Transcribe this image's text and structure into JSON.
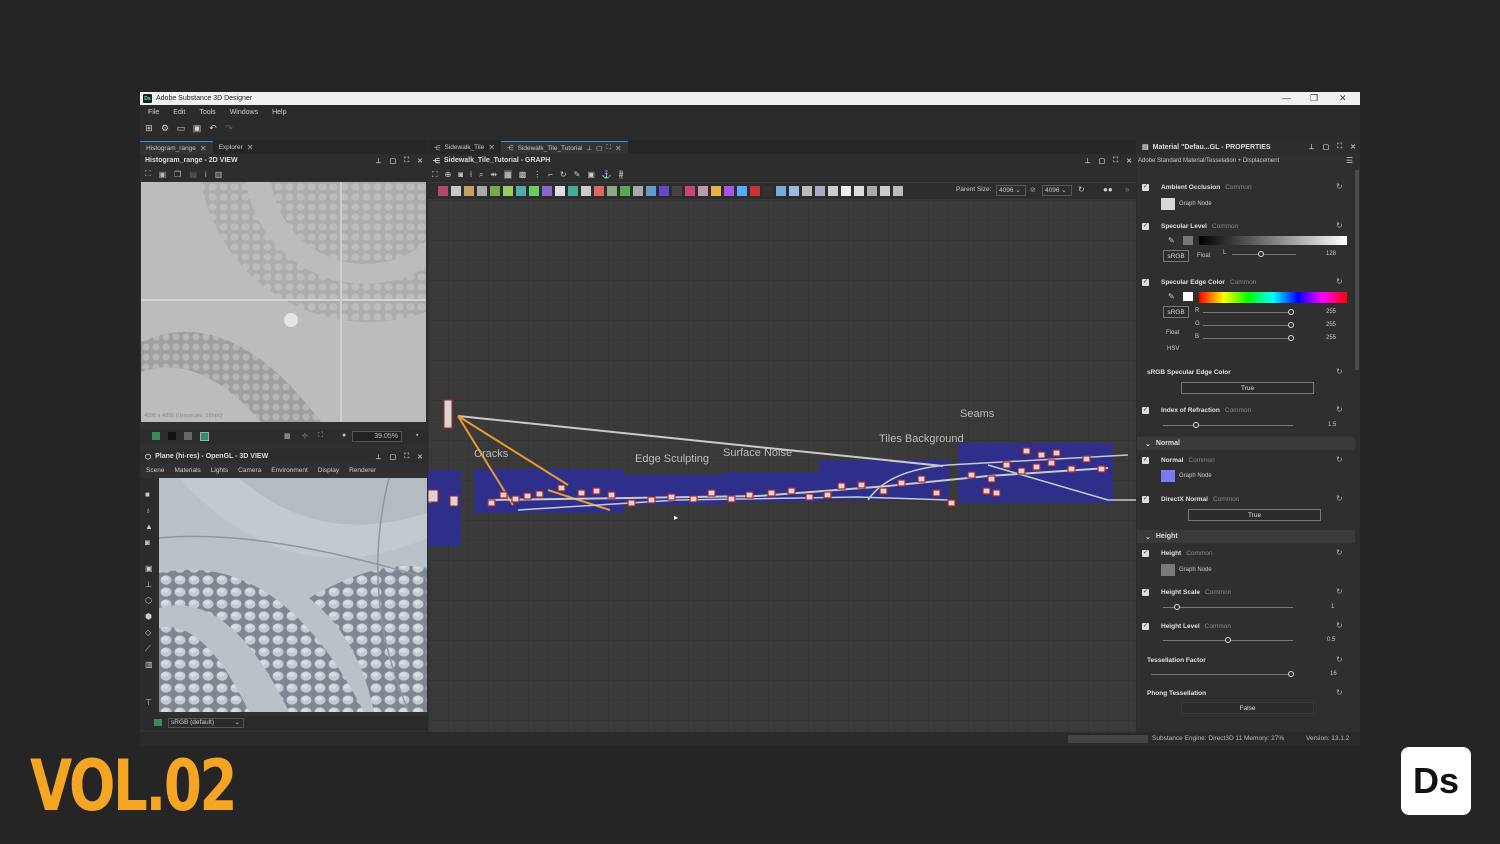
{
  "overlay": {
    "volume": "VOL.02",
    "badge": "Ds"
  },
  "app": {
    "title": "Adobe Substance 3D Designer",
    "logo": "Ds",
    "menu": [
      "File",
      "Edit",
      "Tools",
      "Windows",
      "Help"
    ]
  },
  "left_top": {
    "tabs": [
      "Histogram_range",
      "Explorer"
    ],
    "title": "Histogram_range - 2D VIEW",
    "zoom": "39.05%",
    "caption": "4096 x 4096 (Grayscale, 16bpc)"
  },
  "left_bottom": {
    "title": "Plane (hi-res) - OpenGL - 3D VIEW",
    "menu": [
      "Scene",
      "Materials",
      "Lights",
      "Camera",
      "Environment",
      "Display",
      "Renderer"
    ],
    "colorspace": "sRGB (default)"
  },
  "graph": {
    "tabs": [
      "Sidewalk_Tile",
      "Sidewalk_Tile_Tutorial"
    ],
    "title": "Sidewalk_Tile_Tutorial - GRAPH",
    "parent_size_label": "Parent Size:",
    "parent_size": "4096",
    "size2": "4096",
    "frames": [
      "Cracks",
      "Edge Sculpting",
      "Surface Noise",
      "Tiles Background",
      "Seams"
    ]
  },
  "properties": {
    "title": "Material \"Defau...GL - PROPERTIES",
    "subtitle": "Adobe Standard Material/Tesselation + Displacement",
    "common": "Common",
    "graph_node": "Graph Node",
    "ambient_occlusion": "Ambient Occlusion",
    "specular_level": {
      "label": "Specular Level",
      "srgb": "sRGB",
      "float": "Float",
      "l": "L",
      "value": "128",
      "fraction": 0.5
    },
    "specular_edge_color": {
      "label": "Specular Edge Color",
      "srgb": "sRGB",
      "float": "Float",
      "hsv": "HSV",
      "r": "R",
      "g": "G",
      "b": "B",
      "rv": "255",
      "gv": "255",
      "bv": "255"
    },
    "srgb_specular_edge": {
      "label": "sRGB Specular Edge Color",
      "value": "True"
    },
    "ior": {
      "label": "Index of Refraction",
      "value": "1.5"
    },
    "normal_section": "Normal",
    "normal": "Normal",
    "directx_normal": {
      "label": "DirectX Normal",
      "value": "True"
    },
    "height_section": "Height",
    "height": "Height",
    "height_scale": {
      "label": "Height Scale",
      "value": "1"
    },
    "height_level": {
      "label": "Height Level",
      "value": "0.5"
    },
    "tessellation": {
      "label": "Tessellation Factor",
      "value": "16"
    },
    "phong": {
      "label": "Phong Tessellation",
      "value": "False"
    },
    "colors": {
      "normal_chip": "#7b7bf0",
      "graph_chip": "#7a7a7a"
    }
  },
  "status": {
    "engine": "Substance Engine: Direct3D 11  Memory: 27%",
    "version": "Version: 13.1.2"
  }
}
